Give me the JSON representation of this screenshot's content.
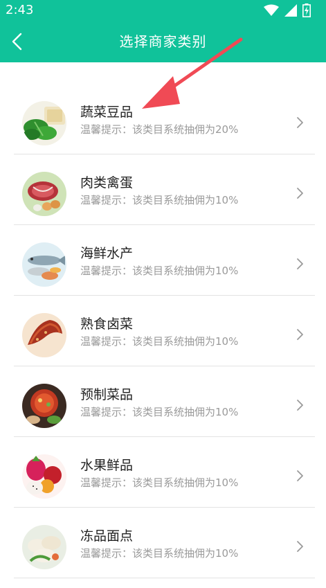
{
  "status_bar": {
    "time": "2:43",
    "icons": [
      "wifi-icon",
      "signal-icon",
      "battery-charging-icon"
    ]
  },
  "header": {
    "title": "选择商家类别",
    "back_icon": "back-arrow-icon",
    "background": "#10c29a"
  },
  "categories": [
    {
      "name": "蔬菜豆品",
      "hint": "温馨提示：该类目系统抽佣为20%",
      "icon": "vegetables-image"
    },
    {
      "name": "肉类禽蛋",
      "hint": "温馨提示：该类目系统抽佣为10%",
      "icon": "meat-eggs-image"
    },
    {
      "name": "海鲜水产",
      "hint": "温馨提示：该类目系统抽佣为10%",
      "icon": "seafood-image"
    },
    {
      "name": "熟食卤菜",
      "hint": "温馨提示：该类目系统抽佣为10%",
      "icon": "cooked-food-image"
    },
    {
      "name": "预制菜品",
      "hint": "温馨提示：该类目系统抽佣为10%",
      "icon": "prepared-dishes-image"
    },
    {
      "name": "水果鲜品",
      "hint": "温馨提示：该类目系统抽佣为10%",
      "icon": "fruit-image"
    },
    {
      "name": "冻品面点",
      "hint": "温馨提示：该类目系统抽佣为10%",
      "icon": "frozen-dough-image"
    }
  ],
  "annotation": {
    "color": "#f04a55"
  }
}
